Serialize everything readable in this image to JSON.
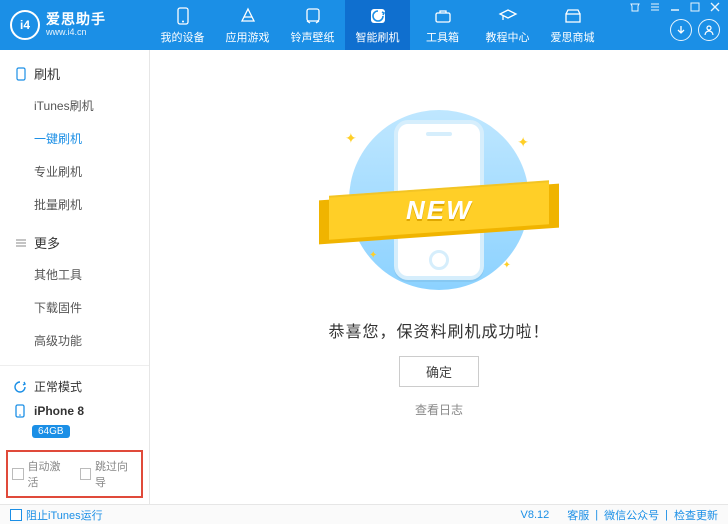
{
  "brand": {
    "logo_letters": "i4",
    "name": "爱思助手",
    "url": "www.i4.cn"
  },
  "nav": [
    {
      "label": "我的设备",
      "icon": "device-icon"
    },
    {
      "label": "应用游戏",
      "icon": "apps-icon"
    },
    {
      "label": "铃声壁纸",
      "icon": "music-icon"
    },
    {
      "label": "智能刷机",
      "icon": "flash-icon",
      "active": true
    },
    {
      "label": "工具箱",
      "icon": "toolbox-icon"
    },
    {
      "label": "教程中心",
      "icon": "tutorial-icon"
    },
    {
      "label": "爱思商城",
      "icon": "store-icon"
    }
  ],
  "sidebar": {
    "groups": [
      {
        "title": "刷机",
        "icon": "phone-outline-icon",
        "items": [
          "iTunes刷机",
          "一键刷机",
          "专业刷机",
          "批量刷机"
        ],
        "active_index": 1
      },
      {
        "title": "更多",
        "icon": "more-icon",
        "items": [
          "其他工具",
          "下载固件",
          "高级功能"
        ],
        "active_index": -1
      }
    ],
    "status": {
      "mode": "正常模式",
      "device": "iPhone 8",
      "storage": "64GB"
    },
    "checks": {
      "auto_activate": "自动激活",
      "skip_wizard": "跳过向导"
    }
  },
  "main": {
    "ribbon_text": "NEW",
    "success": "恭喜您，保资料刷机成功啦！",
    "confirm": "确定",
    "view_log": "查看日志"
  },
  "footer": {
    "block_itunes": "阻止iTunes运行",
    "version": "V8.12",
    "links": [
      "客服",
      "微信公众号",
      "检查更新"
    ]
  }
}
